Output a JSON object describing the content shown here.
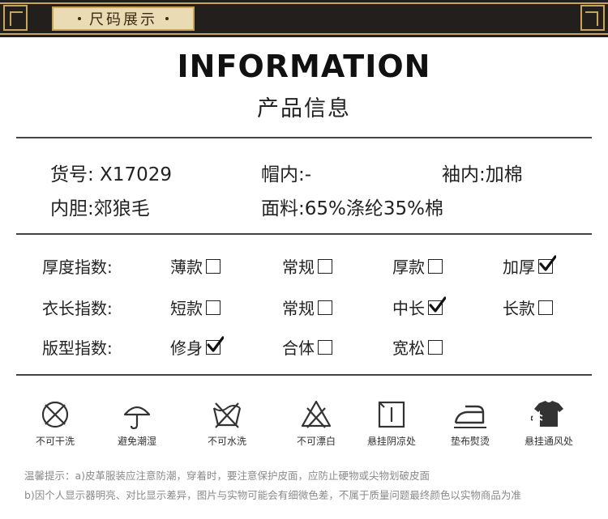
{
  "banner": {
    "label": "尺码展示"
  },
  "title": {
    "en": "INFORMATION",
    "cn": "产品信息"
  },
  "info": {
    "item_no": "货号: X17029",
    "hat_lining": "帽内:-",
    "sleeve_lining": "袖内:加棉",
    "liner": "内胆:郊狼毛",
    "fabric": "面料:65%涤纶35%棉"
  },
  "scales": [
    {
      "label": "厚度指数:",
      "options": [
        {
          "text": "薄款",
          "checked": false
        },
        {
          "text": "常规",
          "checked": false
        },
        {
          "text": "厚款",
          "checked": false
        },
        {
          "text": "加厚",
          "checked": true
        }
      ]
    },
    {
      "label": "衣长指数:",
      "options": [
        {
          "text": "短款",
          "checked": false
        },
        {
          "text": "常规",
          "checked": false
        },
        {
          "text": "中长",
          "checked": true
        },
        {
          "text": "长款",
          "checked": false
        }
      ]
    },
    {
      "label": "版型指数:",
      "options": [
        {
          "text": "修身",
          "checked": true
        },
        {
          "text": "合体",
          "checked": false
        },
        {
          "text": "宽松",
          "checked": false
        }
      ]
    }
  ],
  "care": [
    {
      "icon": "no-wash-icon",
      "caption": "不可干洗"
    },
    {
      "icon": "avoid-moisture-icon",
      "caption": "避免潮湿"
    },
    {
      "icon": "no-water-wash-icon",
      "caption": "不可水洗"
    },
    {
      "icon": "no-bleach-icon",
      "caption": "不可漂白"
    },
    {
      "icon": "hang-dry-shade-icon",
      "caption": "悬挂阴凉处"
    },
    {
      "icon": "iron-with-cloth-icon",
      "caption": "垫布熨烫"
    },
    {
      "icon": "hang-ventilated-icon",
      "caption": "悬挂通风处"
    }
  ],
  "notes": {
    "line1": "温馨提示：a)皮革服装应注意防潮，穿着时，要注意保护皮面，应防止硬物或尖物划破皮面",
    "line2": "b)因个人显示器明亮、对比显示差异，图片与实物可能会有细微色差，不属于质量问题最终颜色以实物商品为准"
  },
  "colors": {
    "banner_bg": "#231f1c",
    "gold": "#c9a45c",
    "note_gray": "#8a8a8a"
  }
}
